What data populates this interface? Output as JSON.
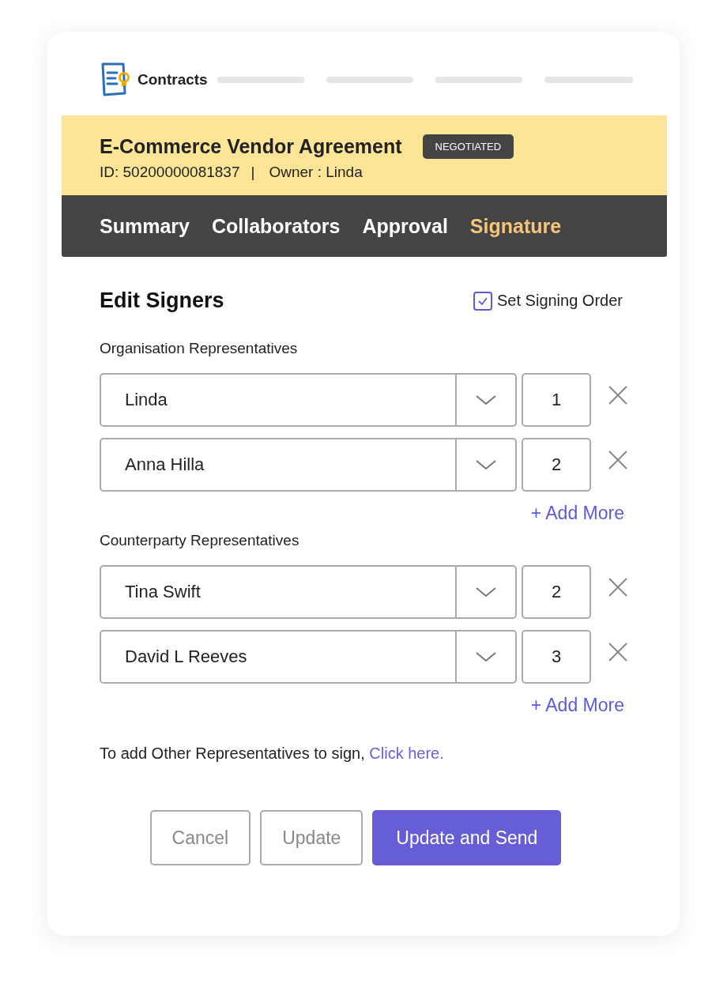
{
  "app": {
    "name": "Contracts"
  },
  "contract": {
    "title": "E-Commerce Vendor Agreement",
    "status": "NEGOTIATED",
    "id_text": "ID: 50200000081837",
    "separator": "|",
    "owner_text": "Owner : Linda"
  },
  "tabs": [
    {
      "label": "Summary",
      "selected": false
    },
    {
      "label": "Collaborators",
      "selected": false
    },
    {
      "label": "Approval",
      "selected": false
    },
    {
      "label": "Signature",
      "selected": true
    }
  ],
  "panel": {
    "title": "Edit Signers",
    "signing_order": {
      "label": "Set Signing Order",
      "checked": true
    }
  },
  "groups": [
    {
      "label": "Organisation Representatives",
      "add_more": "+ Add More",
      "signers": [
        {
          "name": "Linda",
          "order": "1"
        },
        {
          "name": "Anna Hilla",
          "order": "2"
        }
      ]
    },
    {
      "label": "Counterparty Representatives",
      "add_more": "+ Add More",
      "signers": [
        {
          "name": "Tina Swift",
          "order": "2"
        },
        {
          "name": "David L Reeves",
          "order": "3"
        }
      ]
    }
  ],
  "note": {
    "text": "To add Other Representatives to sign,",
    "link": "Click here."
  },
  "buttons": [
    {
      "label": "Cancel",
      "kind": "secondary"
    },
    {
      "label": "Update",
      "kind": "secondary"
    },
    {
      "label": "Update and Send",
      "kind": "primary"
    }
  ]
}
